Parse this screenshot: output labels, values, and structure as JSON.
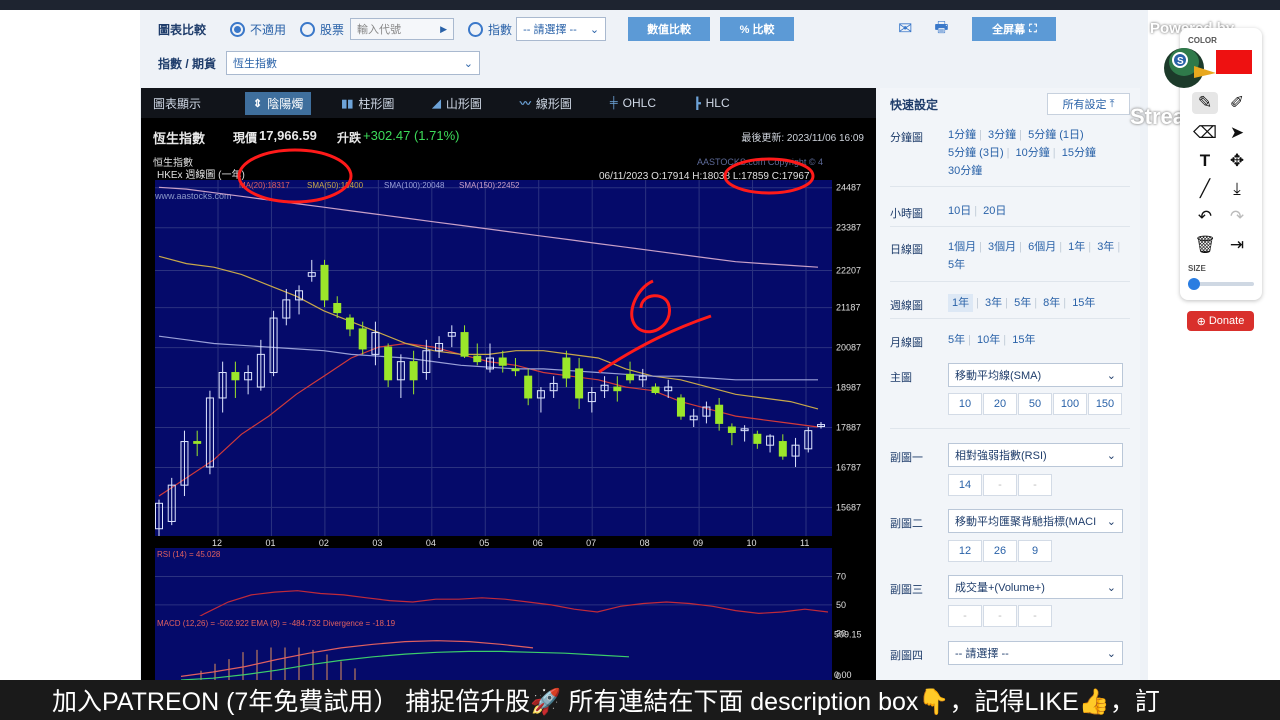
{
  "toolbar": {
    "compare_label": "圖表比較",
    "opt_none": "不適用",
    "opt_stock": "股票",
    "stock_placeholder": "輸入代號",
    "opt_index": "指數",
    "index_select": "-- 請選擇 --",
    "value_compare_btn": "數值比較",
    "pct_compare_btn": "% 比較",
    "fullscreen_btn": "全屏幕"
  },
  "row2": {
    "label": "指數 / 期貨",
    "selected": "恆生指數"
  },
  "chart_tabs": {
    "title": "圖表顯示",
    "items": [
      {
        "icon": "candlestick-icon",
        "label": "陰陽燭",
        "active": true
      },
      {
        "icon": "bar-chart-icon",
        "label": "柱形圖",
        "active": false
      },
      {
        "icon": "mountain-chart-icon",
        "label": "山形圖",
        "active": false
      },
      {
        "icon": "line-chart-icon",
        "label": "線形圖",
        "active": false
      },
      {
        "icon": "ohlc-icon",
        "label": "OHLC",
        "active": false
      },
      {
        "icon": "hlc-icon",
        "label": "HLC",
        "active": false
      }
    ]
  },
  "quote": {
    "name": "恆生指數",
    "price_label": "現價",
    "price": "17,966.59",
    "change_label": "升跌",
    "change": "+302.47 (1.71%)",
    "updated": "最後更新: 2023/11/06 16:09"
  },
  "chart_header": {
    "index_name": "恒生指數",
    "sub_title": "HKEx 週線圖 (一年)",
    "website": "www.aastocks.com",
    "copyright": "AASTOCKS.com Copyright © 4",
    "sma20": "MA(20):18317",
    "sma50": "SMA(50):19400",
    "sma100": "SMA(100):20048",
    "sma150": "SMA(150):22452",
    "ohlc": "06/11/2023   O:17914  H:18038  L:17859  C:17967"
  },
  "chart_data": [
    {
      "type": "candlestick",
      "title": "恒生指數 HKEx 週線圖 (一年)",
      "x_ticks": [
        "12",
        "01",
        "02",
        "03",
        "04",
        "05",
        "06",
        "07",
        "08",
        "09",
        "10",
        "11"
      ],
      "y_ticks": [
        24487,
        23387,
        22207,
        21187,
        20087,
        18987,
        17887,
        16787,
        15687
      ],
      "ylim": [
        14900,
        24700
      ],
      "candles": [
        {
          "o": 15100,
          "h": 15900,
          "l": 14900,
          "c": 15800
        },
        {
          "o": 15300,
          "h": 16500,
          "l": 15200,
          "c": 16300
        },
        {
          "o": 16300,
          "h": 17800,
          "l": 16000,
          "c": 17500
        },
        {
          "o": 17500,
          "h": 17800,
          "l": 17100,
          "c": 17450
        },
        {
          "o": 16800,
          "h": 18900,
          "l": 16600,
          "c": 18700
        },
        {
          "o": 18700,
          "h": 19700,
          "l": 18300,
          "c": 19400
        },
        {
          "o": 19400,
          "h": 19700,
          "l": 18700,
          "c": 19200
        },
        {
          "o": 19200,
          "h": 19600,
          "l": 18800,
          "c": 19400
        },
        {
          "o": 19000,
          "h": 20300,
          "l": 18900,
          "c": 19900
        },
        {
          "o": 19400,
          "h": 21100,
          "l": 19300,
          "c": 20900
        },
        {
          "o": 20900,
          "h": 21700,
          "l": 20700,
          "c": 21400
        },
        {
          "o": 21400,
          "h": 21800,
          "l": 21000,
          "c": 21650
        },
        {
          "o": 22050,
          "h": 22500,
          "l": 21900,
          "c": 22150
        },
        {
          "o": 22350,
          "h": 22500,
          "l": 21200,
          "c": 21400
        },
        {
          "o": 21300,
          "h": 21500,
          "l": 20900,
          "c": 21050
        },
        {
          "o": 20900,
          "h": 21000,
          "l": 20400,
          "c": 20600
        },
        {
          "o": 20600,
          "h": 20800,
          "l": 19900,
          "c": 20050
        },
        {
          "o": 19900,
          "h": 20800,
          "l": 19600,
          "c": 20500
        },
        {
          "o": 20100,
          "h": 20200,
          "l": 19000,
          "c": 19200
        },
        {
          "o": 19200,
          "h": 19900,
          "l": 18700,
          "c": 19700
        },
        {
          "o": 19700,
          "h": 20000,
          "l": 18800,
          "c": 19200
        },
        {
          "o": 19400,
          "h": 20300,
          "l": 19200,
          "c": 20000
        },
        {
          "o": 20000,
          "h": 20400,
          "l": 19800,
          "c": 20200
        },
        {
          "o": 20400,
          "h": 20700,
          "l": 20100,
          "c": 20500
        },
        {
          "o": 20500,
          "h": 20700,
          "l": 19800,
          "c": 19850
        },
        {
          "o": 19850,
          "h": 20200,
          "l": 19600,
          "c": 19700
        },
        {
          "o": 19500,
          "h": 20200,
          "l": 19400,
          "c": 19800
        },
        {
          "o": 19800,
          "h": 20000,
          "l": 19400,
          "c": 19600
        },
        {
          "o": 19500,
          "h": 19800,
          "l": 19300,
          "c": 19450
        },
        {
          "o": 19300,
          "h": 19500,
          "l": 18500,
          "c": 18700
        },
        {
          "o": 18700,
          "h": 19000,
          "l": 18300,
          "c": 18900
        },
        {
          "o": 18900,
          "h": 19300,
          "l": 18700,
          "c": 19100
        },
        {
          "o": 19800,
          "h": 20000,
          "l": 19000,
          "c": 19250
        },
        {
          "o": 19500,
          "h": 19800,
          "l": 18400,
          "c": 18700
        },
        {
          "o": 18600,
          "h": 19000,
          "l": 18300,
          "c": 18850
        },
        {
          "o": 18900,
          "h": 19300,
          "l": 18700,
          "c": 19050
        },
        {
          "o": 19000,
          "h": 19300,
          "l": 18600,
          "c": 18900
        },
        {
          "o": 19350,
          "h": 19700,
          "l": 19100,
          "c": 19200
        },
        {
          "o": 19200,
          "h": 19500,
          "l": 19000,
          "c": 19300
        },
        {
          "o": 19000,
          "h": 19100,
          "l": 18800,
          "c": 18850
        },
        {
          "o": 18900,
          "h": 19200,
          "l": 18700,
          "c": 19000
        },
        {
          "o": 18700,
          "h": 18800,
          "l": 18100,
          "c": 18200
        },
        {
          "o": 18100,
          "h": 18400,
          "l": 17900,
          "c": 18200
        },
        {
          "o": 18200,
          "h": 18600,
          "l": 18000,
          "c": 18450
        },
        {
          "o": 18500,
          "h": 18700,
          "l": 17800,
          "c": 18000
        },
        {
          "o": 17900,
          "h": 18000,
          "l": 17400,
          "c": 17750
        },
        {
          "o": 17800,
          "h": 17950,
          "l": 17500,
          "c": 17850
        },
        {
          "o": 17700,
          "h": 17800,
          "l": 17300,
          "c": 17450
        },
        {
          "o": 17400,
          "h": 17700,
          "l": 17200,
          "c": 17650
        },
        {
          "o": 17500,
          "h": 17700,
          "l": 17000,
          "c": 17100
        },
        {
          "o": 17100,
          "h": 17600,
          "l": 16800,
          "c": 17400
        },
        {
          "o": 17300,
          "h": 17900,
          "l": 17200,
          "c": 17800
        },
        {
          "o": 17914,
          "h": 18038,
          "l": 17859,
          "c": 17967
        }
      ],
      "series": [
        {
          "name": "MA(20)",
          "values": [
            16000,
            16500,
            17000,
            17700,
            18200,
            18800,
            19300,
            19800,
            20100,
            20200,
            20100,
            19900,
            19700,
            19600,
            19400,
            19300,
            19200,
            19000,
            18900,
            18600,
            18400,
            18200,
            18100,
            18000,
            17900
          ]
        },
        {
          "name": "SMA(50)",
          "values": [
            22600,
            22400,
            22300,
            22100,
            21800,
            21500,
            21100,
            20800,
            20500,
            20200,
            20000,
            19900,
            19900,
            20000,
            20000,
            19900,
            19800,
            19500,
            19300,
            19200,
            19000,
            18800,
            18700,
            18600,
            18400
          ]
        },
        {
          "name": "SMA(100)",
          "values": [
            20400,
            20300,
            20200,
            20150,
            20100,
            20050,
            20000,
            19900,
            19850,
            19800,
            19700,
            19600,
            19550,
            19500,
            19500,
            19450,
            19400,
            19350,
            19300,
            19300,
            19250,
            19200,
            19200,
            19200,
            19200
          ]
        },
        {
          "name": "SMA(150)",
          "values": [
            24500,
            24450,
            24350,
            24250,
            24150,
            24050,
            23950,
            23850,
            23750,
            23650,
            23550,
            23450,
            23350,
            23250,
            23150,
            23050,
            22950,
            22850,
            22750,
            22650,
            22550,
            22450,
            22400,
            22350,
            22300
          ]
        }
      ]
    },
    {
      "type": "line",
      "title": "RSI (14) = 45.028",
      "y_ticks": [
        70,
        50,
        30,
        0
      ],
      "ylim": [
        0,
        90
      ],
      "series": [
        {
          "name": "RSI (14)",
          "values": [
            27,
            35,
            44,
            52,
            57,
            59,
            60,
            58,
            57,
            55,
            53,
            52,
            54,
            54,
            55,
            54,
            52,
            50,
            47,
            45,
            49,
            51,
            52,
            51,
            49,
            46,
            44,
            45,
            47,
            45
          ]
        }
      ]
    },
    {
      "type": "bar",
      "title": "MACD (12,26) = -502.922  EMA (9) = -484.732  Divergence = -18.19",
      "y_ticks": [
        509.15,
        0.0
      ],
      "ylim": [
        0,
        560
      ],
      "series": [
        {
          "name": "MACD (12,26)",
          "values": [
            40,
            90,
            150,
            230,
            300,
            360,
            400,
            430,
            440,
            430,
            400,
            360
          ]
        },
        {
          "name": "EMA (9)",
          "values": [
            0,
            20,
            60,
            110,
            170,
            220,
            260,
            290,
            310,
            320,
            320,
            310,
            300,
            280,
            260
          ]
        },
        {
          "name": "Divergence",
          "values": [
            40,
            70,
            90,
            120,
            130,
            140,
            140,
            140,
            130,
            110,
            80,
            50
          ]
        }
      ]
    }
  ],
  "sidebar": {
    "title": "快速設定",
    "all_settings": "所有設定",
    "min_label": "分鐘圖",
    "min_links": [
      "1分鐘",
      "3分鐘",
      "5分鐘 (1日)",
      "5分鐘 (3日)",
      "10分鐘",
      "15分鐘",
      "30分鐘"
    ],
    "hour_label": "小時圖",
    "hour_links": [
      "10日",
      "20日"
    ],
    "day_label": "日線圖",
    "day_links": [
      "1個月",
      "3個月",
      "6個月",
      "1年",
      "3年",
      "5年"
    ],
    "week_label": "週線圖",
    "week_links": [
      "1年",
      "3年",
      "5年",
      "8年",
      "15年"
    ],
    "month_label": "月線圖",
    "month_links": [
      "5年",
      "10年",
      "15年"
    ],
    "main_label": "主圖",
    "main_select": "移動平均線(SMA)",
    "main_params": [
      "10",
      "20",
      "50",
      "100",
      "150"
    ],
    "sub1_label": "副圖一",
    "sub1_select": "相對強弱指數(RSI)",
    "sub1_params": [
      "14",
      "-",
      "-"
    ],
    "sub2_label": "副圖二",
    "sub2_select": "移動平均匯聚背馳指標(MACI",
    "sub2_params": [
      "12",
      "26",
      "9"
    ],
    "sub3_label": "副圖三",
    "sub3_select": "成交量+(Volume+)",
    "sub3_params": [
      "-",
      "-",
      "-"
    ],
    "sub4_label": "副圖四",
    "sub4_select": "-- 請選擇 --"
  },
  "overlay": {
    "powered_by": "Powered by",
    "brand": "StreamYard",
    "color_label": "COLOR",
    "size_label": "SIZE",
    "donate": "Donate"
  },
  "caption": {
    "text": "加入PATREON (7年免費試用） 捕捉倍升股🚀 所有連結在下面 description box👇，記得LIKE👍，訂"
  }
}
